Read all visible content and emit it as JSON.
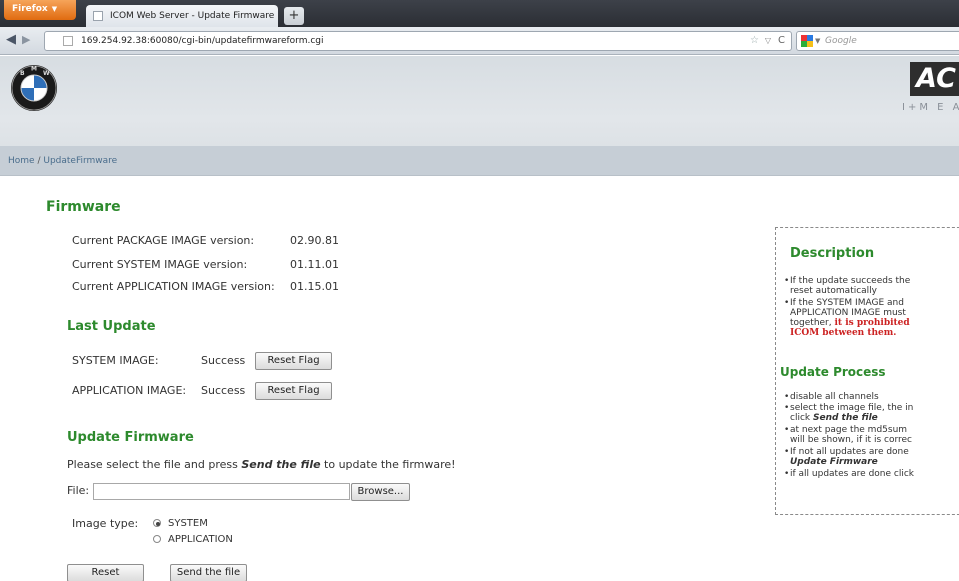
{
  "browser": {
    "menu_label": "Firefox",
    "tab_title": "ICOM Web Server - Update Firmware",
    "new_tab": "+",
    "url": "169.254.92.38:60080/cgi-bin/updatefirmwareform.cgi",
    "search_placeholder": "Google"
  },
  "header": {
    "brand_partial": "AC",
    "brand_sub_partial": "I+M E A"
  },
  "breadcrumb": {
    "home": "Home",
    "separator": "/",
    "current": "UpdateFirmware"
  },
  "firmware": {
    "title": "Firmware",
    "versions": [
      {
        "label": "Current PACKAGE IMAGE version:",
        "value": "02.90.81"
      },
      {
        "label": "Current SYSTEM IMAGE version:",
        "value": "01.11.01"
      },
      {
        "label": "Current APPLICATION IMAGE version:",
        "value": "01.15.01"
      }
    ]
  },
  "last_update": {
    "title": "Last Update",
    "rows": [
      {
        "label": "SYSTEM IMAGE:",
        "status": "Success",
        "button": "Reset Flag"
      },
      {
        "label": "APPLICATION IMAGE:",
        "status": "Success",
        "button": "Reset Flag"
      }
    ]
  },
  "update_firmware": {
    "title": "Update Firmware",
    "instruction_prefix": "Please select the file and press ",
    "instruction_emphasis": "Send the file",
    "instruction_suffix": " to update the firmware!",
    "file_label": "File:",
    "file_value": "",
    "browse_label": "Browse...",
    "image_type_label": "Image type:",
    "image_types": [
      {
        "label": "SYSTEM",
        "checked": true
      },
      {
        "label": "APPLICATION",
        "checked": false
      }
    ],
    "reset_label": "Reset",
    "send_label": "Send the file"
  },
  "description": {
    "title": "Description",
    "items": [
      {
        "lines": [
          "If the update succeeds the",
          "reset automatically"
        ]
      },
      {
        "lines": [
          "If the SYSTEM IMAGE and",
          "APPLICATION IMAGE must",
          "together, "
        ],
        "red": [
          "it is prohibited",
          "ICOM between them."
        ]
      }
    ],
    "process_title": "Update Process",
    "process_items": [
      {
        "lines": [
          "disable all channels"
        ]
      },
      {
        "lines": [
          "select the image file, the in",
          "click "
        ],
        "emphasis": "Send the file"
      },
      {
        "lines": [
          "at next page the md5sum",
          "will be shown, if it is correc"
        ]
      },
      {
        "lines": [
          "If not all updates are done"
        ],
        "emphasis": "Update Firmware"
      },
      {
        "lines": [
          "if all updates are done click"
        ]
      }
    ]
  },
  "colors": {
    "heading_green": "#2d8a2d",
    "warning_red": "#cc2222",
    "breadcrumb_bar": "#c6ced6",
    "header_bg": "#dde2e6"
  }
}
